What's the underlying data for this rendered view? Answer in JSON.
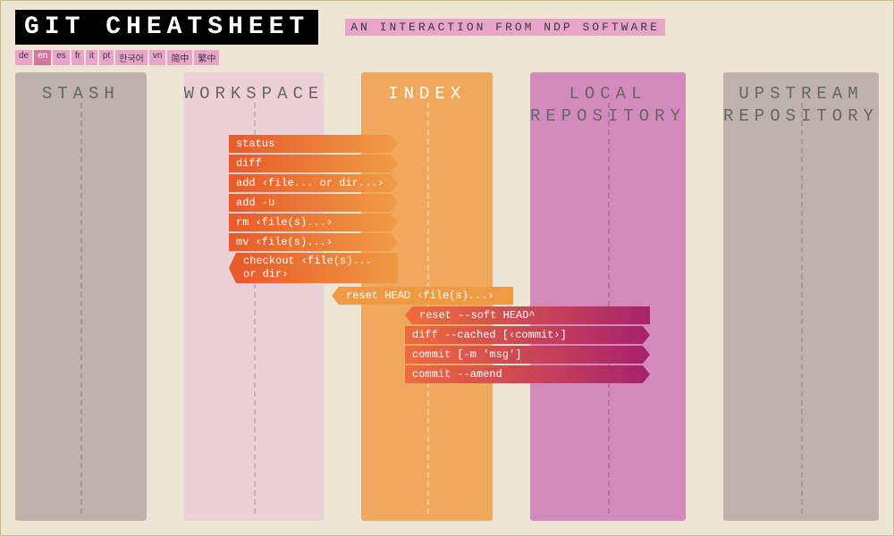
{
  "header": {
    "title": "GIT CHEATSHEET",
    "subtitle": "AN INTERACTION FROM NDP SOFTWARE"
  },
  "langs": [
    "de",
    "en",
    "es",
    "fr",
    "it",
    "pt",
    "한국어",
    "vn",
    "简中",
    "繁中"
  ],
  "activeLang": "en",
  "cols": [
    "STASH",
    "WORKSPACE",
    "INDEX",
    "LOCAL REPOSITORY",
    "UPSTREAM REPOSITORY"
  ],
  "cmds": {
    "status": "status",
    "diff": "diff",
    "add": "add ‹file... or dir...›",
    "addu": "add -u",
    "rm": "rm ‹file(s)...›",
    "mv": "mv ‹file(s)...›",
    "checkout": "checkout ‹file(s)... or dir›",
    "resetHead": "reset HEAD ‹file(s)...›",
    "resetSoft": "reset --soft HEAD^",
    "diffCached": "diff --cached [‹commit›]",
    "commitMsg": "commit [-m 'msg']",
    "commitAmend": "commit --amend"
  }
}
